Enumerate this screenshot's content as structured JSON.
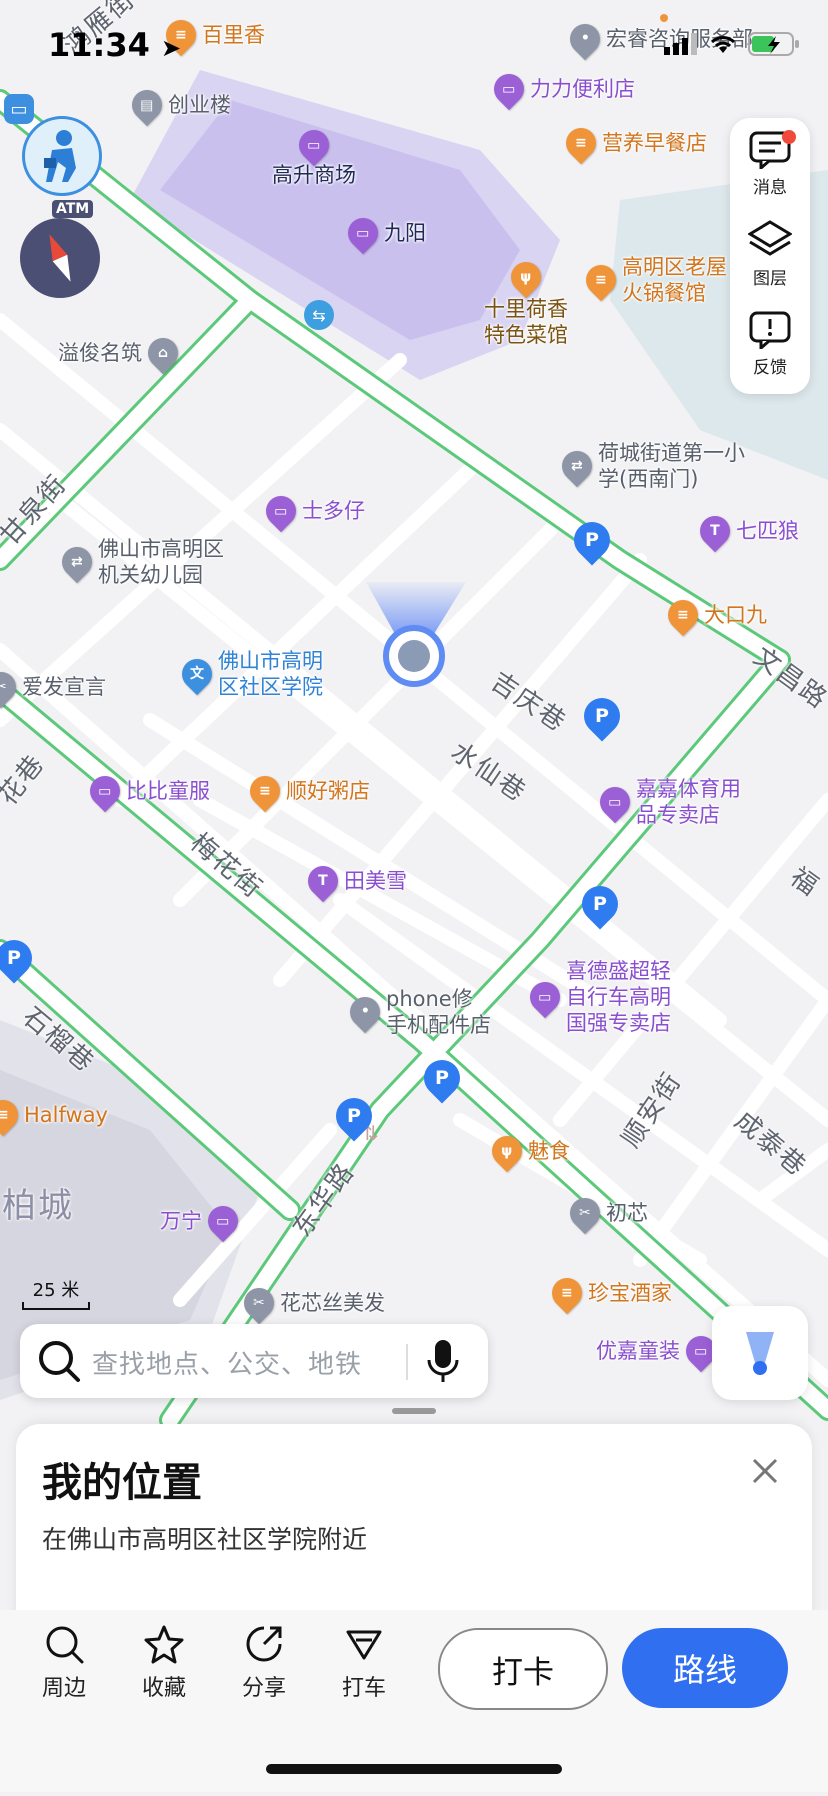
{
  "status_bar": {
    "time": "11:34"
  },
  "map": {
    "scale_label": "25 米",
    "atm_label": "ATM",
    "pois": [
      {
        "label": "百里香",
        "color": "orange",
        "glyph": "≡"
      },
      {
        "label": "宏睿咨询服务部",
        "color": "gray",
        "glyph": "•"
      },
      {
        "label": "创业楼",
        "color": "gray",
        "glyph": "▤"
      },
      {
        "label": "力力便利店",
        "color": "purple",
        "glyph": "▭"
      },
      {
        "label": "高升商场",
        "color": "purple",
        "glyph": "▭"
      },
      {
        "label": "营养早餐店",
        "color": "orange",
        "glyph": "≡"
      },
      {
        "label": "九阳",
        "color": "purple",
        "glyph": "▭"
      },
      {
        "label": "高明区老屋\n火锅餐馆",
        "color": "orange",
        "glyph": "≡"
      },
      {
        "label": "十里荷香\n特色菜馆",
        "color": "brown",
        "glyph": "ψ"
      },
      {
        "label": "溢俊名筑",
        "color": "gray",
        "glyph": "⌂"
      },
      {
        "label": "荷城街道第一小\n学(西南门)",
        "color": "gray",
        "glyph": "⇄"
      },
      {
        "label": "士多仔",
        "color": "purple",
        "glyph": "▭"
      },
      {
        "label": "七匹狼",
        "color": "purple",
        "glyph": "T"
      },
      {
        "label": "佛山市高明区\n机关幼儿园",
        "color": "gray",
        "glyph": "⇄"
      },
      {
        "label": "大口九",
        "color": "orange",
        "glyph": "≡"
      },
      {
        "label": "佛山市高明\n区社区学院",
        "color": "blue",
        "glyph": "文"
      },
      {
        "label": "爱发宣言",
        "color": "gray",
        "glyph": "✂"
      },
      {
        "label": "比比童服",
        "color": "purple",
        "glyph": "▭"
      },
      {
        "label": "顺好粥店",
        "color": "orange",
        "glyph": "≡"
      },
      {
        "label": "嘉嘉体育用\n品专卖店",
        "color": "purple",
        "glyph": "▭"
      },
      {
        "label": "田美雪",
        "color": "purple",
        "glyph": "T"
      },
      {
        "label": "喜德盛超轻\n自行车高明\n国强专卖店",
        "color": "purple",
        "glyph": "▭"
      },
      {
        "label": "phone修\n手机配件店",
        "color": "gray",
        "glyph": "•"
      },
      {
        "label": "Halfway",
        "color": "orange",
        "glyph": "≡"
      },
      {
        "label": "魅食",
        "color": "orange",
        "glyph": "ψ"
      },
      {
        "label": "万宁",
        "color": "purple",
        "glyph": "▭"
      },
      {
        "label": "初芯",
        "color": "gray",
        "glyph": "✂"
      },
      {
        "label": "花芯丝美发",
        "color": "gray",
        "glyph": "✂"
      },
      {
        "label": "珍宝酒家",
        "color": "orange",
        "glyph": "≡"
      },
      {
        "label": "优嘉童装",
        "color": "purple",
        "glyph": "▭"
      }
    ],
    "roads": [
      "鸿雁街",
      "甘泉街",
      "文昌路",
      "吉庆巷",
      "水仙巷",
      "梅花街",
      "石榴巷",
      "东华路",
      "顺安街",
      "成泰巷",
      "福",
      "花巷",
      "柏城"
    ]
  },
  "right_panel": {
    "messages": "消息",
    "layers": "图层",
    "feedback": "反馈"
  },
  "search": {
    "placeholder": "查找地点、公交、地铁"
  },
  "sheet": {
    "title": "我的位置",
    "subtitle": "在佛山市高明区社区学院附近"
  },
  "bottom_nav": {
    "nearby": "周边",
    "favorites": "收藏",
    "share": "分享",
    "taxi": "打车",
    "checkin": "打卡",
    "route": "路线"
  },
  "colors": {
    "accent": "#2f6ff0",
    "road_border": "#5cc97a",
    "notification": "#f04a3a"
  }
}
